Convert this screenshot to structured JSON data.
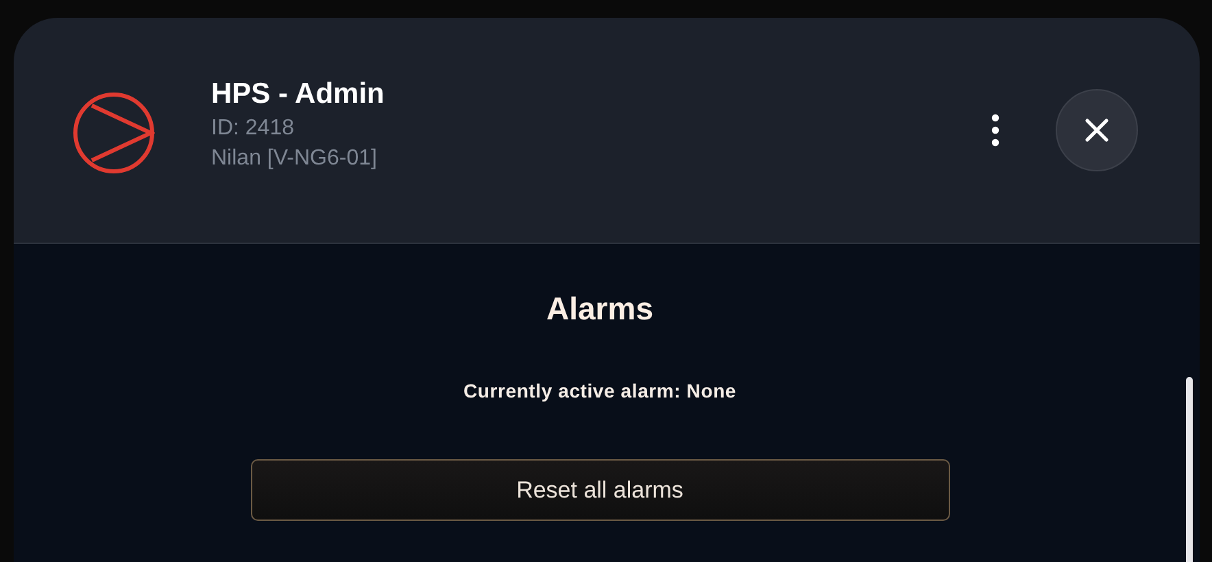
{
  "header": {
    "title": "HPS - Admin",
    "id_line": "ID: 2418",
    "model_line": "Nilan [V-NG6-01]"
  },
  "section": {
    "title": "Alarms",
    "status": "Currently active alarm: None",
    "reset_button": "Reset all alarms"
  }
}
